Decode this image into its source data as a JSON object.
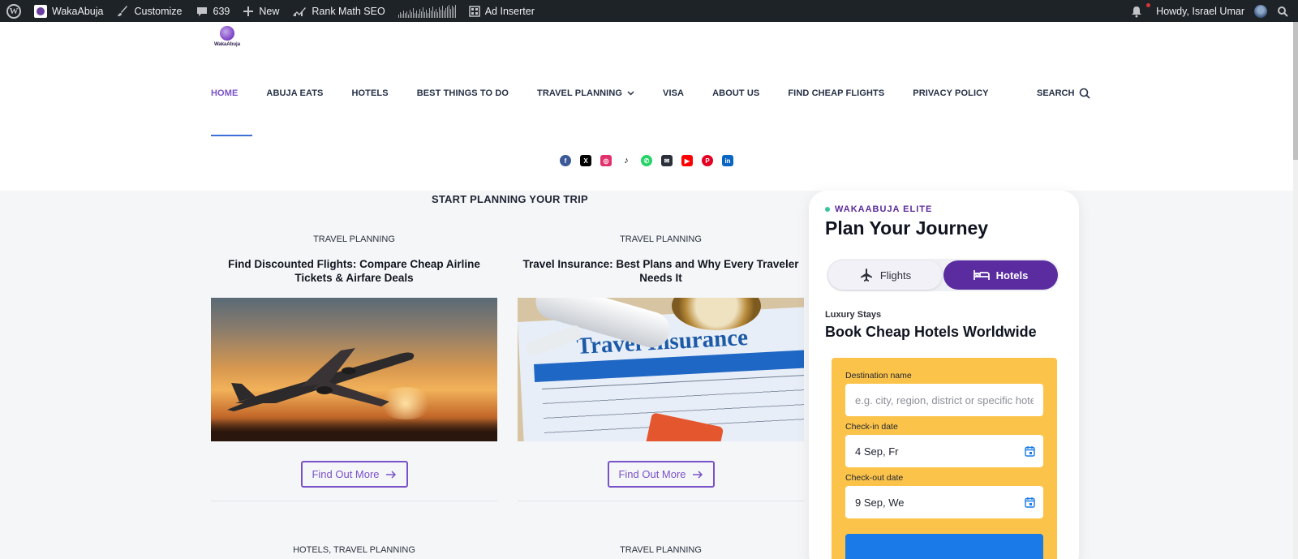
{
  "admin_bar": {
    "site_name": "WakaAbuja",
    "customize": "Customize",
    "comments_count": "639",
    "new_label": "New",
    "rank_math": "Rank Math SEO",
    "ad_inserter": "Ad Inserter",
    "howdy": "Howdy, Israel Umar"
  },
  "header": {
    "logo_text": "WakaAbuja",
    "nav": [
      {
        "label": "HOME",
        "active": true
      },
      {
        "label": "ABUJA EATS"
      },
      {
        "label": "HOTELS"
      },
      {
        "label": "BEST THINGS TO DO"
      },
      {
        "label": "TRAVEL PLANNING",
        "has_dropdown": true
      },
      {
        "label": "VISA"
      },
      {
        "label": "ABOUT US"
      },
      {
        "label": "FIND CHEAP FLIGHTS"
      },
      {
        "label": "PRIVACY POLICY"
      }
    ],
    "search_label": "SEARCH",
    "socials": [
      "facebook-icon",
      "x-icon",
      "instagram-icon",
      "tiktok-icon",
      "whatsapp-icon",
      "email-icon",
      "youtube-icon",
      "pinterest-icon",
      "linkedin-icon"
    ]
  },
  "main": {
    "section_title": "START PLANNING YOUR TRIP",
    "posts": [
      {
        "category": "TRAVEL PLANNING",
        "title": "Find Discounted Flights: Compare Cheap Airline Tickets & Airfare Deals",
        "button": "Find Out More"
      },
      {
        "category": "TRAVEL PLANNING",
        "title": "Travel Insurance: Best Plans and Why Every Traveler Needs It",
        "button": "Find Out More",
        "image_text": "Travel Insurance"
      }
    ],
    "next_posts": [
      {
        "category": "HOTELS, TRAVEL PLANNING"
      },
      {
        "category": "TRAVEL PLANNING"
      }
    ]
  },
  "widget": {
    "badge": "WAKAABUJA ELITE",
    "title": "Plan Your Journey",
    "tabs": {
      "flights": "Flights",
      "hotels": "Hotels",
      "active": "hotels"
    },
    "subtitle": "Luxury Stays",
    "heading": "Book Cheap Hotels Worldwide",
    "form": {
      "destination_label": "Destination name",
      "destination_placeholder": "e.g. city, region, district or specific hotel",
      "checkin_label": "Check-in date",
      "checkin_value": "4 Sep, Fr",
      "checkout_label": "Check-out date",
      "checkout_value": "9 Sep, We"
    }
  },
  "colors": {
    "accent": "#7a52c8",
    "hotel_tab": "#5a2ca0",
    "form_bg": "#fbc34a",
    "search_button": "#1a7ae8",
    "admin_bar": "#1d2327"
  }
}
